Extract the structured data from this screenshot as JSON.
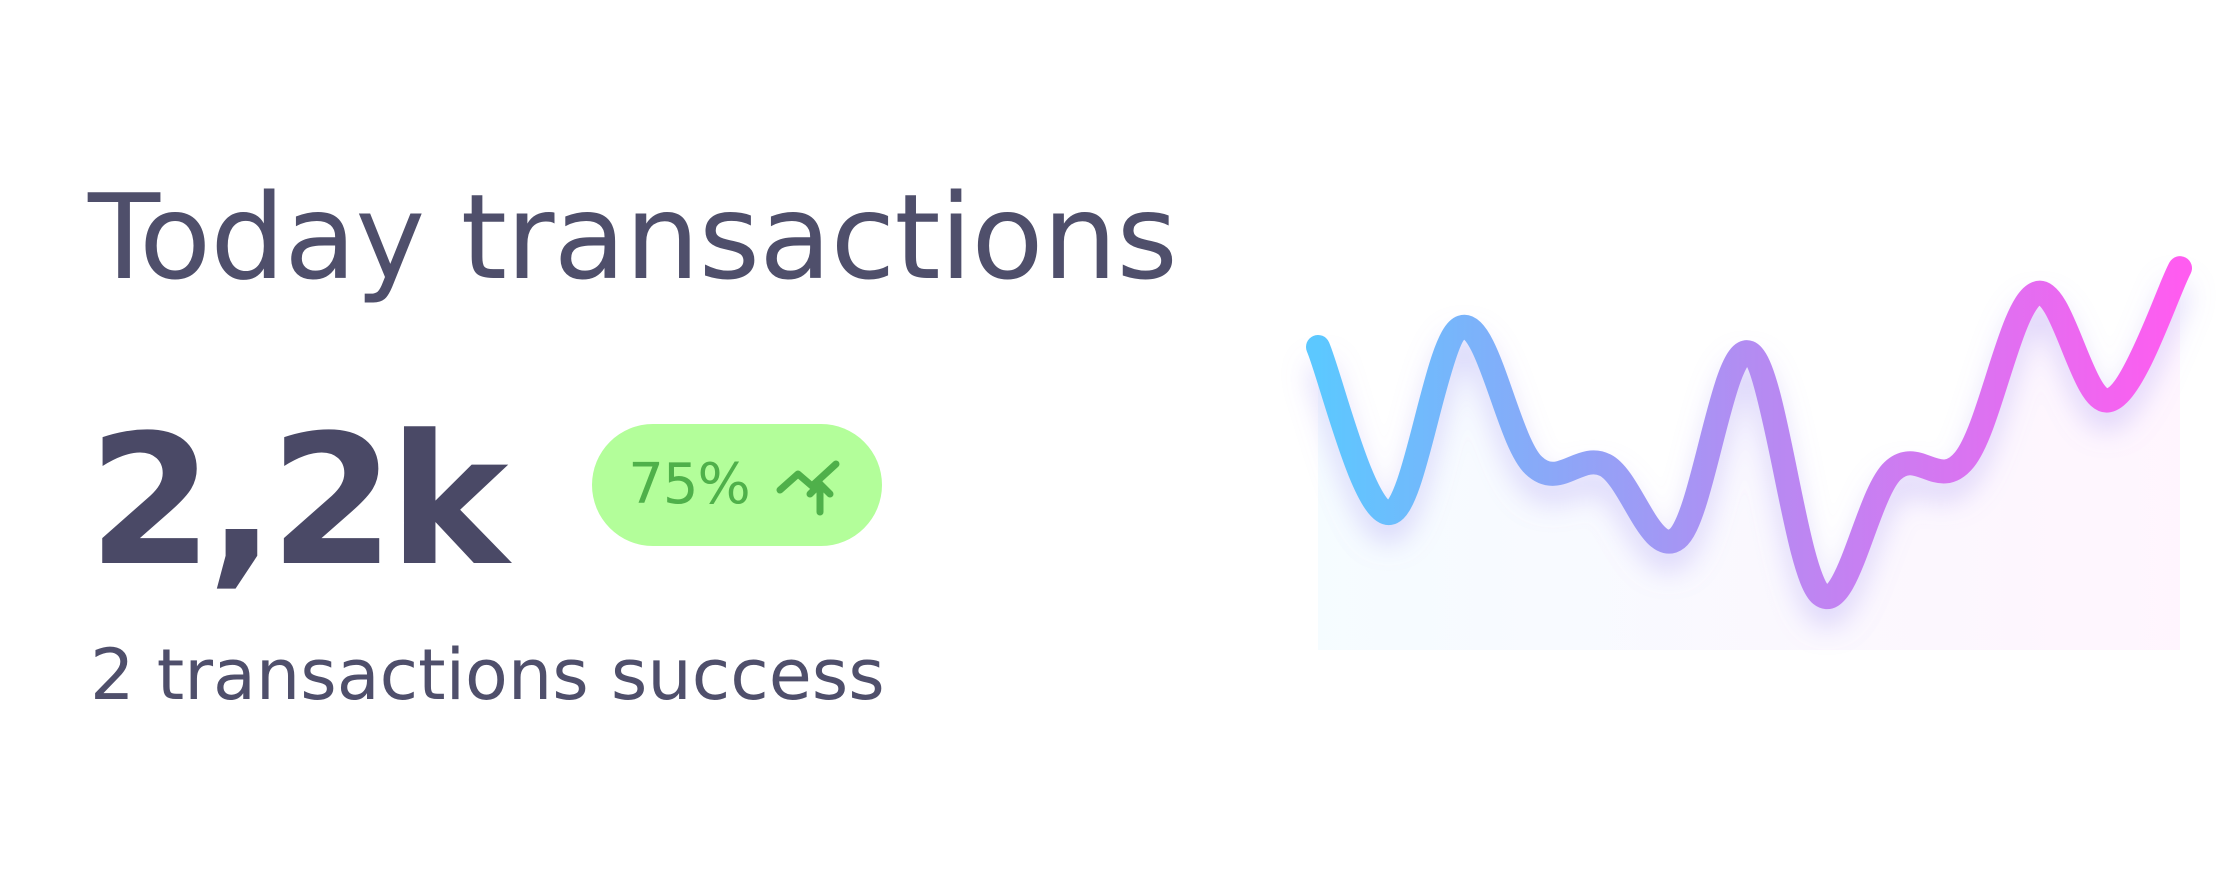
{
  "widget": {
    "title": "Today transactions",
    "value": "2,2k",
    "badge": {
      "label": "75%",
      "icon": "trending-up-icon",
      "bg_color": "#b3fe9a",
      "text_color": "#4fb04a"
    },
    "subtitle": "2 transactions success"
  },
  "chart_data": {
    "type": "line",
    "title": "",
    "xlabel": "",
    "ylabel": "",
    "grid": false,
    "legend": "none",
    "gradient_colors": [
      "#5cc8ff",
      "#b38cf2",
      "#ff5cf0"
    ],
    "x": [
      0,
      1,
      2,
      3,
      4,
      5,
      6,
      7,
      8,
      9,
      10,
      11,
      12,
      13,
      14
    ],
    "series": [
      {
        "values": [
          72,
          13,
          79,
          30,
          30,
          4,
          70,
          -16,
          28,
          32,
          91,
          53,
          100
        ]
      }
    ],
    "ylim": [
      -25,
      110
    ]
  }
}
